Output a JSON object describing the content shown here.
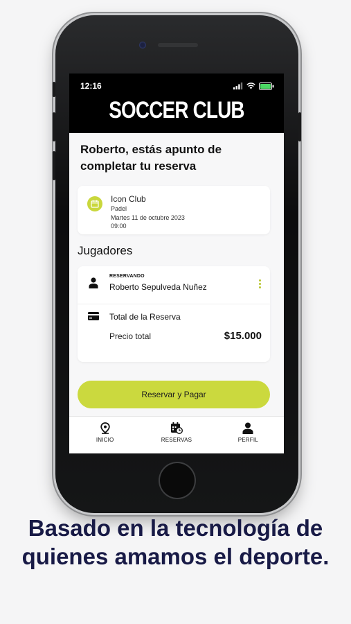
{
  "status_bar": {
    "time": "12:16"
  },
  "app": {
    "brand": "SOCCER CLUB"
  },
  "booking": {
    "title": "Roberto, estás apunto de completar tu reserva",
    "club": {
      "name": "Icon Club",
      "sport": "Padel",
      "date": "Martes 11 de octubre 2023",
      "time": "09:00"
    }
  },
  "players": {
    "heading": "Jugadores",
    "role_tag": "RESERVANDO",
    "name": "Roberto Sepulveda Nuñez"
  },
  "summary": {
    "title": "Total de la Reserva",
    "price_label": "Precio total",
    "price_value": "$15.000"
  },
  "actions": {
    "pay_label": "Reservar y Pagar"
  },
  "tabs": [
    {
      "label": "INICIO",
      "icon": "location-pin-icon"
    },
    {
      "label": "RESERVAS",
      "icon": "calendar-clock-icon"
    },
    {
      "label": "PERFIL",
      "icon": "user-icon"
    }
  ],
  "tagline": "Basado en la tecnología de quienes amamos el deporte.",
  "colors": {
    "accent": "#cbd93e",
    "tagline": "#181a46",
    "header": "#000000"
  }
}
